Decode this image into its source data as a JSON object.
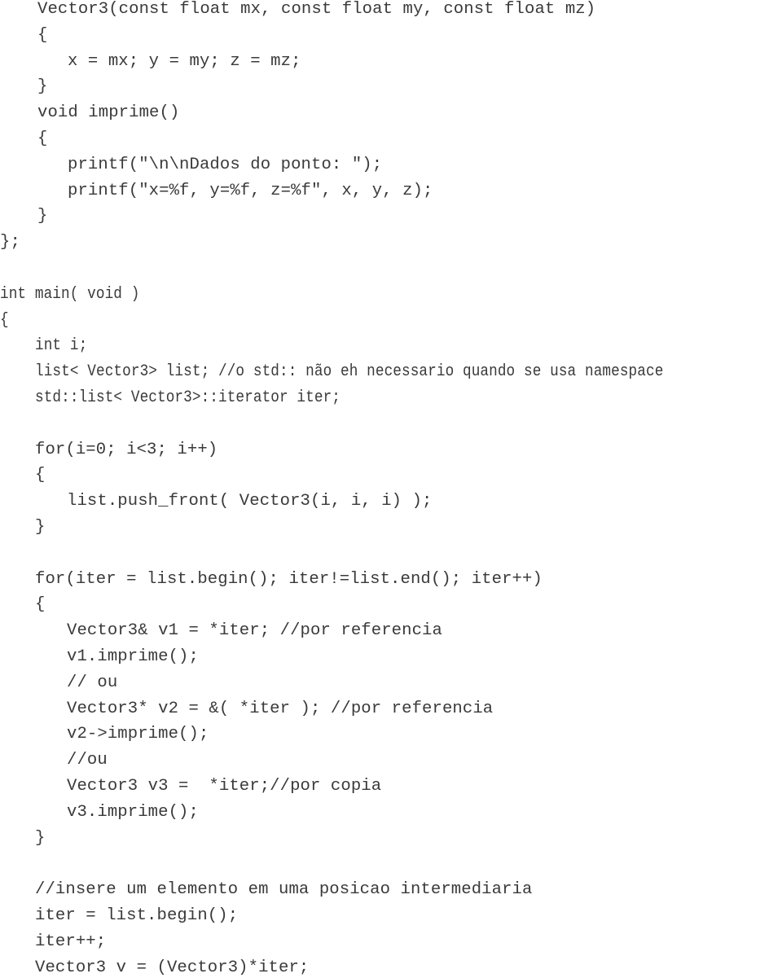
{
  "document": {
    "language": "C++",
    "lines": [
      {
        "text": "Vector3(const float mx, const float my, const float mz)",
        "indent": 1
      },
      {
        "text": "{",
        "indent": 1
      },
      {
        "text": "x = mx; y = my; z = mz;",
        "indent": 2
      },
      {
        "text": "}",
        "indent": 1
      },
      {
        "text": "void imprime()",
        "indent": 1
      },
      {
        "text": "{",
        "indent": 1
      },
      {
        "text": "printf(\"\\n\\nDados do ponto: \");",
        "indent": 2
      },
      {
        "text": "printf(\"x=%f, y=%f, z=%f\", x, y, z);",
        "indent": 2
      },
      {
        "text": "}",
        "indent": 1
      },
      {
        "text": "};",
        "indent": 0
      },
      {
        "text": "",
        "indent": 0
      },
      {
        "text": "int main( void )",
        "indent": 0
      },
      {
        "text": "{",
        "indent": 0
      },
      {
        "text": "int i;",
        "indent": 1
      },
      {
        "text": "list< Vector3> list; //o std:: não eh necessario quando se usa namespace",
        "indent": 1
      },
      {
        "text": "std::list< Vector3>::iterator iter;",
        "indent": 1
      },
      {
        "text": "",
        "indent": 0
      },
      {
        "text": "for(i=0; i<3; i++)",
        "indent": 1
      },
      {
        "text": "{",
        "indent": 1
      },
      {
        "text": "list.push_front( Vector3(i, i, i) );",
        "indent": 2
      },
      {
        "text": "}",
        "indent": 1
      },
      {
        "text": "",
        "indent": 0
      },
      {
        "text": "for(iter = list.begin(); iter!=list.end(); iter++)",
        "indent": 1
      },
      {
        "text": "{",
        "indent": 1
      },
      {
        "text": "Vector3& v1 = *iter; //por referencia",
        "indent": 2
      },
      {
        "text": "v1.imprime();",
        "indent": 2
      },
      {
        "text": "// ou",
        "indent": 2
      },
      {
        "text": "Vector3* v2 = &( *iter ); //por referencia",
        "indent": 2
      },
      {
        "text": "v2->imprime();",
        "indent": 2
      },
      {
        "text": "//ou",
        "indent": 2
      },
      {
        "text": "Vector3 v3 =  *iter;//por copia",
        "indent": 2
      },
      {
        "text": "v3.imprime();",
        "indent": 2
      },
      {
        "text": "}",
        "indent": 1
      },
      {
        "text": "",
        "indent": 0
      },
      {
        "text": "//insere um elemento em uma posicao intermediaria",
        "indent": 1
      },
      {
        "text": "iter = list.begin();",
        "indent": 1
      },
      {
        "text": "iter++;",
        "indent": 1
      },
      {
        "text": "Vector3 v = (Vector3)*iter;",
        "indent": 1
      }
    ]
  }
}
